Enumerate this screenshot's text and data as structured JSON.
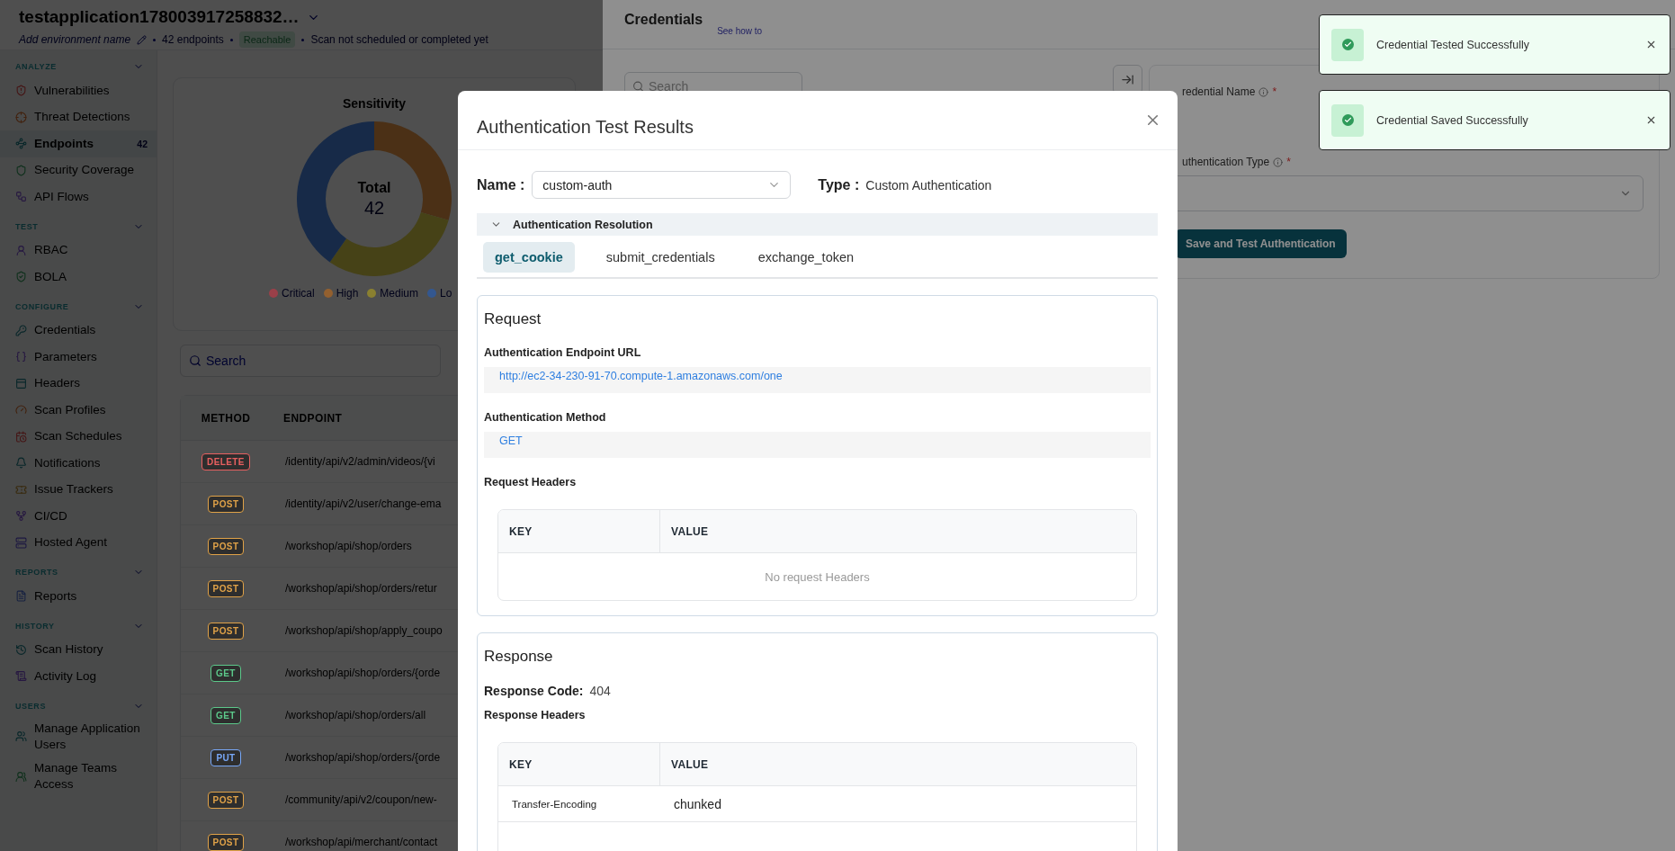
{
  "app_header": {
    "title": "testapplication178003917258832…",
    "environment_placeholder": "Add environment name",
    "endpoint_count": "42 endpoints",
    "status_badge": "Reachable",
    "scan_status": "Scan not scheduled or completed yet"
  },
  "sidebar": {
    "sections": [
      {
        "title": "ANALYZE",
        "expanded": true,
        "items": [
          {
            "label": "Vulnerabilities",
            "selected": false
          },
          {
            "label": "Threat Detections",
            "selected": false
          },
          {
            "label": "Endpoints",
            "selected": true,
            "badge": "42"
          },
          {
            "label": "Security Coverage",
            "selected": false
          },
          {
            "label": "API Flows",
            "selected": false
          }
        ]
      },
      {
        "title": "TEST",
        "expanded": true,
        "items": [
          {
            "label": "RBAC",
            "selected": false
          },
          {
            "label": "BOLA",
            "selected": false
          }
        ]
      },
      {
        "title": "CONFIGURE",
        "expanded": true,
        "items": [
          {
            "label": "Credentials",
            "selected": false
          },
          {
            "label": "Parameters",
            "selected": false
          },
          {
            "label": "Headers",
            "selected": false
          },
          {
            "label": "Scan Profiles",
            "selected": false
          },
          {
            "label": "Scan Schedules",
            "selected": false
          },
          {
            "label": "Notifications",
            "selected": false
          },
          {
            "label": "Issue Trackers",
            "selected": false
          },
          {
            "label": "CI/CD",
            "selected": false
          },
          {
            "label": "Hosted Agent",
            "selected": false
          }
        ]
      },
      {
        "title": "REPORTS",
        "expanded": true,
        "items": [
          {
            "label": "Reports",
            "selected": false
          }
        ]
      },
      {
        "title": "HISTORY",
        "expanded": true,
        "items": [
          {
            "label": "Scan History",
            "selected": false
          },
          {
            "label": "Activity Log",
            "selected": false
          }
        ]
      },
      {
        "title": "USERS",
        "expanded": true,
        "items": [
          {
            "label": "Manage Application Users",
            "selected": false
          },
          {
            "label": "Manage Teams Access",
            "selected": false
          }
        ]
      }
    ]
  },
  "sensitivity_card": {
    "title": "Sensitivity",
    "total_label": "Total",
    "total_value": "42",
    "legend": [
      {
        "label": "Critical",
        "color": "#9a4049"
      },
      {
        "label": "High",
        "color": "#93602f"
      },
      {
        "label": "Medium",
        "color": "#8a8030"
      },
      {
        "label": "Lo",
        "color": "#33578f"
      }
    ]
  },
  "endpoint_search": {
    "placeholder": "Search"
  },
  "endpoints_table": {
    "columns": [
      "METHOD",
      "ENDPOINT"
    ],
    "rows": [
      {
        "method": "DELETE",
        "color": "#e86060",
        "endpoint": "/identity/api/v2/admin/videos/{vi"
      },
      {
        "method": "POST",
        "color": "#e0a248",
        "endpoint": "/identity/api/v2/user/change-ema"
      },
      {
        "method": "POST",
        "color": "#e0a248",
        "endpoint": "/workshop/api/shop/orders"
      },
      {
        "method": "POST",
        "color": "#e0a248",
        "endpoint": "/workshop/api/shop/orders/retur"
      },
      {
        "method": "POST",
        "color": "#e0a248",
        "endpoint": "/workshop/api/shop/apply_coupo"
      },
      {
        "method": "GET",
        "color": "#5cc88a",
        "endpoint": "/workshop/api/shop/orders/{orde"
      },
      {
        "method": "GET",
        "color": "#5cc88a",
        "endpoint": "/workshop/api/shop/orders/all"
      },
      {
        "method": "PUT",
        "color": "#78a8f8",
        "endpoint": "/workshop/api/shop/orders/{orde"
      },
      {
        "method": "POST",
        "color": "#e0a248",
        "endpoint": "/community/api/v2/coupon/new-"
      },
      {
        "method": "POST",
        "color": "#e0a248",
        "endpoint": "/workshop/api/merchant/contact"
      }
    ]
  },
  "credentials_drawer": {
    "title": "Credentials",
    "help_link": "See how to",
    "search": {
      "placeholder": "Search"
    },
    "fields": [
      {
        "label": "redential Name",
        "required_mark": "*",
        "kind": "text"
      },
      {
        "label": "uthentication Type",
        "required_mark": "*",
        "kind": "select"
      }
    ],
    "submit_button": "Save and Test Authentication"
  },
  "toasts": [
    {
      "message": "Credential Tested Successfully"
    },
    {
      "message": "Credential Saved Successfully"
    }
  ],
  "modal": {
    "title": "Authentication Test Results",
    "name_label": "Name :",
    "name_value": "custom-auth",
    "type_label": "Type :",
    "type_value": "Custom Authentication",
    "accordion": {
      "title": "Authentication Resolution",
      "expanded": true
    },
    "tabs": [
      {
        "label": "get_cookie",
        "selected": true
      },
      {
        "label": "submit_credentials",
        "selected": false
      },
      {
        "label": "exchange_token",
        "selected": false
      }
    ],
    "request": {
      "title": "Request",
      "fields": [
        {
          "label": "Authentication Endpoint URL",
          "value": "http://ec2-34-230-91-70.compute-1.amazonaws.com/one"
        },
        {
          "label": "Authentication Method",
          "value": "GET"
        }
      ],
      "headers_title": "Request Headers",
      "headers_table": {
        "columns": [
          "KEY",
          "VALUE"
        ],
        "empty_message": "No request Headers"
      }
    },
    "response": {
      "title": "Response",
      "code_label": "Response Code:",
      "code": "404",
      "headers_title": "Response Headers",
      "headers_table": {
        "columns": [
          "KEY",
          "VALUE"
        ],
        "rows": [
          {
            "key": "Transfer-Encoding",
            "value": "chunked"
          }
        ]
      }
    }
  }
}
